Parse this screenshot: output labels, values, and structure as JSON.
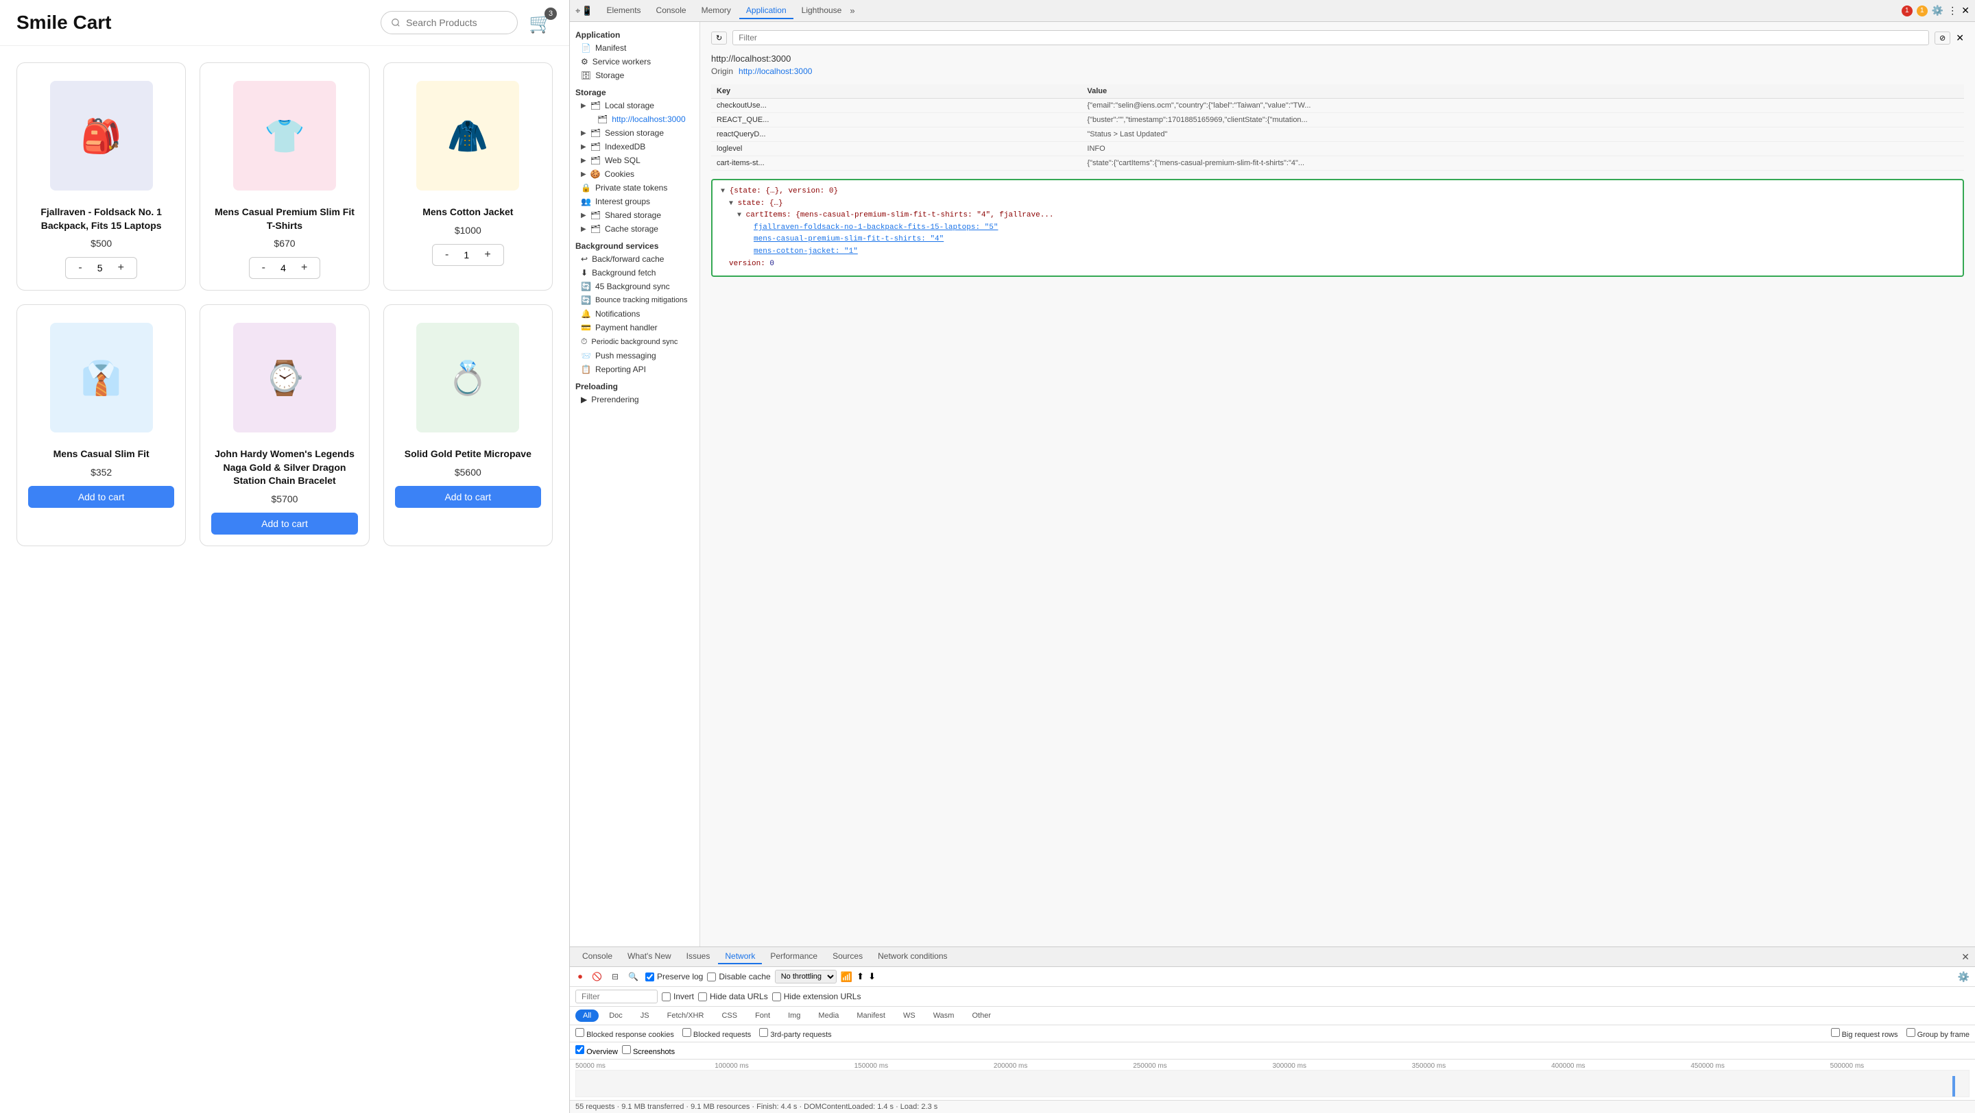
{
  "shop": {
    "title": "Smile Cart",
    "search_placeholder": "Search Products",
    "cart_count": "3",
    "products": [
      {
        "id": "fjallraven-foldsack-no-1-backpack-fits-15-laptops",
        "name": "Fjallraven - Foldsack No. 1 Backpack, Fits 15 Laptops",
        "price": "$500",
        "qty": "5",
        "emoji": "🎒",
        "bg": "#e8eaf6",
        "has_qty": true
      },
      {
        "id": "mens-casual-premium-slim-fit-t-shirts",
        "name": "Mens Casual Premium Slim Fit T-Shirts",
        "price": "$670",
        "qty": "4",
        "emoji": "👕",
        "bg": "#fce4ec",
        "has_qty": true
      },
      {
        "id": "mens-cotton-jacket",
        "name": "Mens Cotton Jacket",
        "price": "$1000",
        "qty": "1",
        "emoji": "🧥",
        "bg": "#fff8e1",
        "has_qty": true
      },
      {
        "id": "mens-casual-slim-fit",
        "name": "Mens Casual Slim Fit",
        "price": "$352",
        "qty": "",
        "emoji": "👔",
        "bg": "#e3f2fd",
        "has_qty": false
      },
      {
        "id": "john-hardy-womens-legends-naga",
        "name": "John Hardy Women's Legends Naga Gold & Silver Dragon Station Chain Bracelet",
        "price": "$5700",
        "qty": "",
        "emoji": "⌚",
        "bg": "#f3e5f5",
        "has_qty": false
      },
      {
        "id": "solid-gold-petite-micropave",
        "name": "Solid Gold Petite Micropave",
        "price": "$5600",
        "qty": "",
        "emoji": "💍",
        "bg": "#e8f5e9",
        "has_qty": false
      }
    ],
    "add_to_cart_label": "Add to cart"
  },
  "devtools": {
    "top_tabs": [
      "Elements",
      "Console",
      "Memory",
      "Application",
      "Lighthouse"
    ],
    "active_top_tab": "Application",
    "error_count": "1",
    "warn_count": "1",
    "filter_placeholder": "Filter",
    "url": "http://localhost:3000",
    "origin_label": "Origin",
    "origin_value": "http://localhost:3000",
    "table_headers": [
      "Key",
      "Value"
    ],
    "table_rows": [
      {
        "key": "checkoutUse...",
        "value": "{\"email\":\"selin@iens.ocm\",\"country\":{\"label\":\"Taiwan\",\"value\":\"TW..."
      },
      {
        "key": "REACT_QUE...",
        "value": "{\"buster\":\"\",\"timestamp\":1701885165969,\"clientState\":{\"mutation..."
      },
      {
        "key": "reactQueryD...",
        "value": "\"Status > Last Updated\""
      },
      {
        "key": "loglevel",
        "value": "INFO"
      },
      {
        "key": "cart-items-st...",
        "value": "{\"state\":{\"cartItems\":{\"mens-casual-premium-slim-fit-t-shirts\":\"4\"..."
      }
    ],
    "json_view": {
      "root": "{state: {…}, version: 0}",
      "state_key": "state: {…}",
      "cart_items_key": "cartItems: {mens-casual-premium-slim-fit-t-shirts: \"4\", fjallrave...",
      "fjallraven_link": "fjallraven-foldsack-no-1-backpack-fits-15-laptops: \"5\"",
      "mens_casual_link": "mens-casual-premium-slim-fit-t-shirts: \"4\"",
      "mens_cotton_link": "mens-cotton-jacket: \"1\"",
      "version_key": "version: 0"
    },
    "sidebar": {
      "application_header": "Application",
      "manifest": "Manifest",
      "service_workers": "Service workers",
      "storage_header": "Storage",
      "local_storage": "Local storage",
      "localhost": "http://localhost:3000",
      "session_storage": "Session storage",
      "indexed_db": "IndexedDB",
      "web_sql": "Web SQL",
      "cookies": "Cookies",
      "private_state_tokens": "Private state tokens",
      "interest_groups": "Interest groups",
      "shared_storage": "Shared storage",
      "cache_storage": "Cache storage",
      "background_services": "Background services",
      "back_forward_cache": "Back/forward cache",
      "background_fetch": "Background fetch",
      "background_sync": "45 Background sync",
      "bounce_tracking": "Bounce tracking mitigations",
      "notifications": "Notifications",
      "payment_handler": "Payment handler",
      "periodic_bg_sync": "Periodic background sync",
      "push_messaging": "Push messaging",
      "reporting_api": "Reporting API",
      "preloading": "Preloading",
      "prerendering": "Prerendering"
    },
    "bottom_tabs": [
      "Console",
      "What's New",
      "Issues",
      "Network",
      "Performance",
      "Sources",
      "Network conditions"
    ],
    "active_bottom_tab": "Network",
    "network": {
      "filter_placeholder": "Filter",
      "preserve_log": "Preserve log",
      "disable_cache": "Disable cache",
      "throttle": "No throttling",
      "invert": "Invert",
      "hide_data_urls": "Hide data URLs",
      "hide_extension_urls": "Hide extension URLs",
      "pills": [
        "All",
        "Doc",
        "JS",
        "Fetch/XHR",
        "CSS",
        "Font",
        "Img",
        "Media",
        "Manifest",
        "WS",
        "Wasm",
        "Other"
      ],
      "active_pill": "All",
      "blocked_response": "Blocked response cookies",
      "blocked_requests": "Blocked requests",
      "third_party": "3rd-party requests",
      "big_request_rows": "Big request rows",
      "group_by_frame": "Group by frame",
      "overview": "Overview",
      "screenshots": "Screenshots",
      "timeline_labels": [
        "50000 ms",
        "100000 ms",
        "150000 ms",
        "200000 ms",
        "250000 ms",
        "300000 ms",
        "350000 ms",
        "400000 ms",
        "450000 ms",
        "500000 ms"
      ],
      "status": "55 requests  ·  9.1 MB transferred  ·  9.1 MB resources  ·  Finish: 4.4 s  ·  DOMContentLoaded: 1.4 s  ·  Load: 2.3 s"
    }
  }
}
